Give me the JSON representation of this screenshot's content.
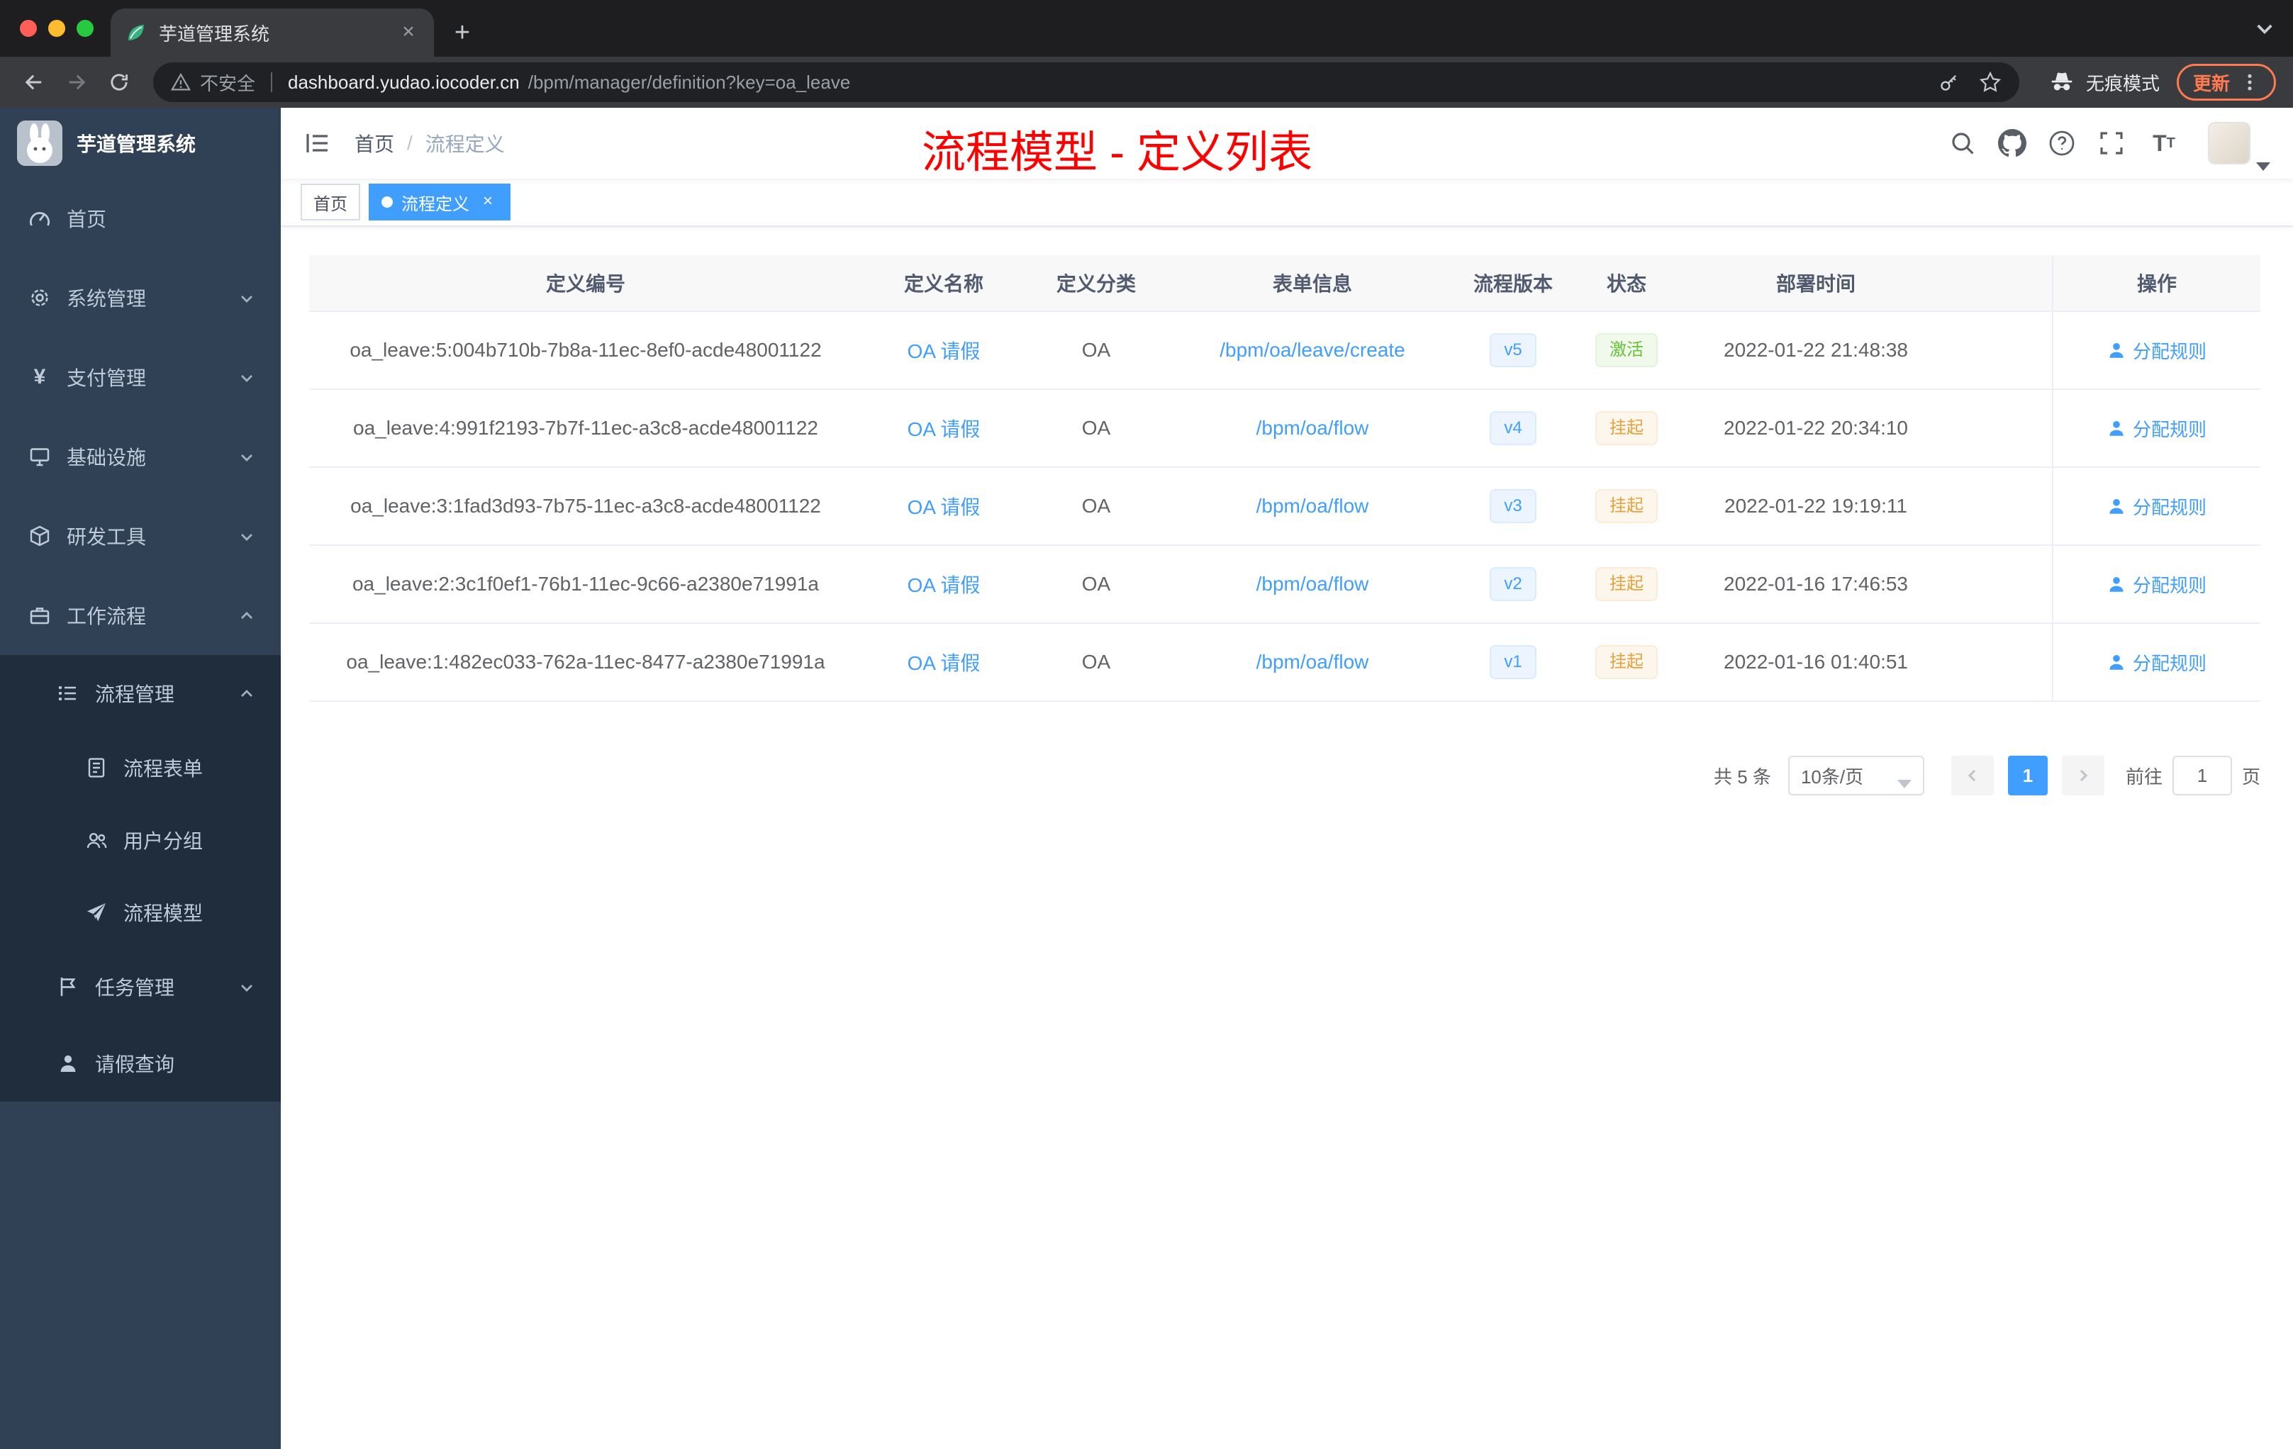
{
  "browser": {
    "tab_title": "芋道管理系统",
    "security_label": "不安全",
    "url_host": "dashboard.yudao.iocoder.cn",
    "url_path": "/bpm/manager/definition?key=oa_leave",
    "incognito_label": "无痕模式",
    "update_label": "更新"
  },
  "sidebar": {
    "logo_title": "芋道管理系统",
    "items": [
      {
        "key": "home",
        "label": "首页",
        "icon": "dashboard-icon",
        "level": 1,
        "arrow": "none"
      },
      {
        "key": "system-mgmt",
        "label": "系统管理",
        "icon": "gear-icon",
        "level": 1,
        "arrow": "down"
      },
      {
        "key": "payment-mgmt",
        "label": "支付管理",
        "icon": "yen-icon",
        "level": 1,
        "arrow": "down"
      },
      {
        "key": "infrastructure",
        "label": "基础设施",
        "icon": "infrastructure-icon",
        "level": 1,
        "arrow": "down"
      },
      {
        "key": "dev-tools",
        "label": "研发工具",
        "icon": "devtools-icon",
        "level": 1,
        "arrow": "down"
      },
      {
        "key": "workflow",
        "label": "工作流程",
        "icon": "workflow-icon",
        "level": 1,
        "arrow": "up"
      },
      {
        "key": "process-mgmt",
        "label": "流程管理",
        "icon": "process-list-icon",
        "level": 2,
        "arrow": "up"
      },
      {
        "key": "process-form",
        "label": "流程表单",
        "icon": "form-icon",
        "level": 3,
        "arrow": "none"
      },
      {
        "key": "user-group",
        "label": "用户分组",
        "icon": "user-group-icon",
        "level": 3,
        "arrow": "none"
      },
      {
        "key": "process-model",
        "label": "流程模型",
        "icon": "send-icon",
        "level": 3,
        "arrow": "none"
      },
      {
        "key": "task-mgmt",
        "label": "任务管理",
        "icon": "task-icon",
        "level": 2,
        "arrow": "down"
      },
      {
        "key": "leave-query",
        "label": "请假查询",
        "icon": "user-icon",
        "level": 2,
        "arrow": "none"
      }
    ]
  },
  "navbar": {
    "breadcrumb": [
      "首页",
      "流程定义"
    ],
    "annotation": "流程模型 - 定义列表"
  },
  "tags": [
    {
      "key": "home",
      "label": "首页",
      "active": false
    },
    {
      "key": "process-definition",
      "label": "流程定义",
      "active": true
    }
  ],
  "table": {
    "columns": [
      {
        "key": "id",
        "label": "定义编号"
      },
      {
        "key": "name",
        "label": "定义名称"
      },
      {
        "key": "category",
        "label": "定义分类"
      },
      {
        "key": "form",
        "label": "表单信息"
      },
      {
        "key": "version",
        "label": "流程版本"
      },
      {
        "key": "status",
        "label": "状态"
      },
      {
        "key": "time",
        "label": "部署时间"
      },
      {
        "key": "op",
        "label": "操作"
      }
    ],
    "op_label": "分配规则",
    "rows": [
      {
        "id": "oa_leave:5:004b710b-7b8a-11ec-8ef0-acde48001122",
        "name": "OA 请假",
        "category": "OA",
        "form": "/bpm/oa/leave/create",
        "version": "v5",
        "status": "激活",
        "status_type": "success",
        "time": "2022-01-22 21:48:38"
      },
      {
        "id": "oa_leave:4:991f2193-7b7f-11ec-a3c8-acde48001122",
        "name": "OA 请假",
        "category": "OA",
        "form": "/bpm/oa/flow",
        "version": "v4",
        "status": "挂起",
        "status_type": "warning",
        "time": "2022-01-22 20:34:10"
      },
      {
        "id": "oa_leave:3:1fad3d93-7b75-11ec-a3c8-acde48001122",
        "name": "OA 请假",
        "category": "OA",
        "form": "/bpm/oa/flow",
        "version": "v3",
        "status": "挂起",
        "status_type": "warning",
        "time": "2022-01-22 19:19:11"
      },
      {
        "id": "oa_leave:2:3c1f0ef1-76b1-11ec-9c66-a2380e71991a",
        "name": "OA 请假",
        "category": "OA",
        "form": "/bpm/oa/flow",
        "version": "v2",
        "status": "挂起",
        "status_type": "warning",
        "time": "2022-01-16 17:46:53"
      },
      {
        "id": "oa_leave:1:482ec033-762a-11ec-8477-a2380e71991a",
        "name": "OA 请假",
        "category": "OA",
        "form": "/bpm/oa/flow",
        "version": "v1",
        "status": "挂起",
        "status_type": "warning",
        "time": "2022-01-16 01:40:51"
      }
    ]
  },
  "pagination": {
    "total": "共 5 条",
    "page_size": "10条/页",
    "current_page": "1",
    "goto_prefix": "前往",
    "goto_value": "1",
    "goto_suffix": "页"
  },
  "colors": {
    "accent": "#409eff",
    "success": "#67c23a",
    "warning": "#e6a23c",
    "annotation_red": "#ff0000",
    "sidebar_bg": "#304156",
    "submenu_bg": "#1f2d3d"
  }
}
